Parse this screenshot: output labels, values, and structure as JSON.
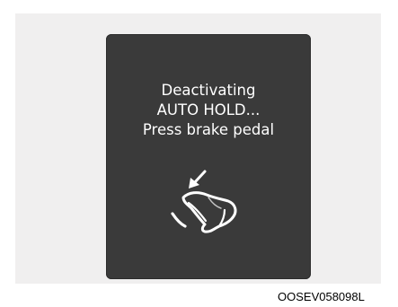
{
  "display": {
    "message_lines": [
      "Deactivating",
      "AUTO HOLD...",
      "Press brake pedal"
    ],
    "icon": "foot-pressing-brake-pedal-icon",
    "background_color": "#3a3a3a",
    "text_color": "#ffffff"
  },
  "caption": "OOSEV058098L"
}
